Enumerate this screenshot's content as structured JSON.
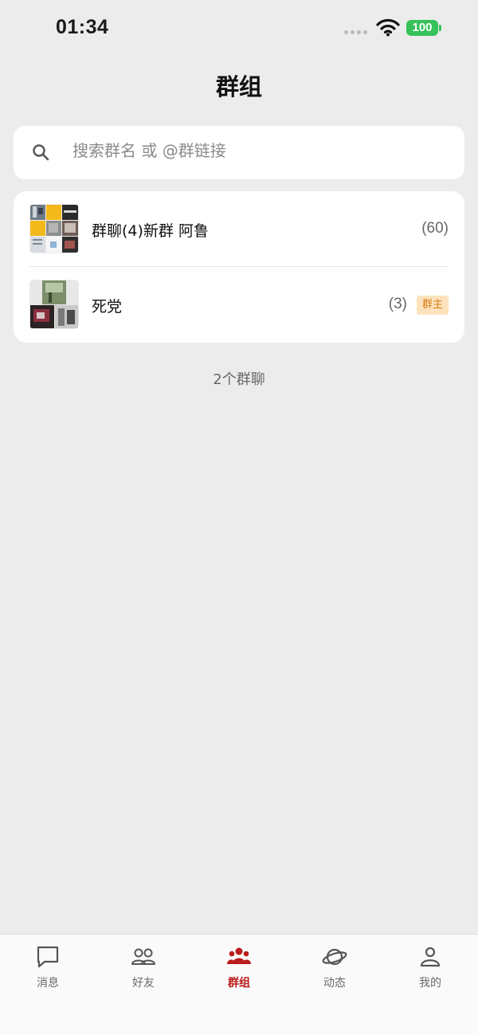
{
  "status_bar": {
    "time": "01:34",
    "battery": "100"
  },
  "page_title": "群组",
  "search": {
    "placeholder": "搜索群名 或 @群链接"
  },
  "groups": [
    {
      "name": "群聊(4)新群 阿鲁",
      "count": "(60)",
      "avatar_icon": "group-collage-avatar"
    },
    {
      "name": "死党",
      "count": "(3)",
      "badge": "群主",
      "avatar_icon": "group-collage-avatar"
    }
  ],
  "total": "2个群聊",
  "tabs": [
    {
      "label": "消息",
      "icon": "message-icon"
    },
    {
      "label": "好友",
      "icon": "friends-icon"
    },
    {
      "label": "群组",
      "icon": "groups-icon",
      "active": true
    },
    {
      "label": "动态",
      "icon": "planet-icon"
    },
    {
      "label": "我的",
      "icon": "profile-icon"
    }
  ],
  "colors": {
    "accent": "#b91c1c",
    "badge_bg": "#fde3bd",
    "badge_text": "#d97b12",
    "battery": "#36c25a"
  }
}
